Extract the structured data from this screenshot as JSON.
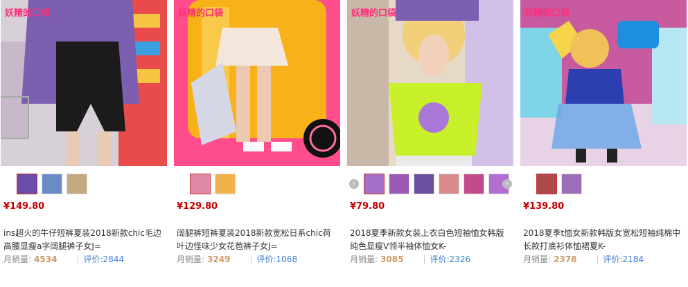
{
  "brand": "妖精的口袋",
  "products": [
    {
      "price": "¥149.80",
      "title": "ins超火的牛仔短裤夏装2018新款chic毛边高腰显瘦a字阔腿裤子女J=",
      "sales_label": "月销量:",
      "sales": "4534",
      "reviews_label": "评价:",
      "reviews": "2844",
      "colors": {
        "bg": "#7c5fb0",
        "accent": "#1b1b1b",
        "shelf": "#e94b4b"
      },
      "thumbs": [
        {
          "color": "#6b4ca8"
        },
        {
          "color": "#6a8cc4"
        },
        {
          "color": "#c4a882"
        }
      ]
    },
    {
      "price": "¥129.80",
      "title": "阔腿裤短裤夏装2018新款宽松日系chic荷叶边怪味少女花苞裤子女J=",
      "sales_label": "月销量:",
      "sales": "3249",
      "reviews_label": "评价:",
      "reviews": "1068",
      "colors": {
        "bg": "#f7b21a",
        "accent": "#f4e6dc",
        "shelf": "#ff4d8d"
      },
      "thumbs": [
        {
          "color": "#e08aa5"
        },
        {
          "color": "#f2b24a"
        }
      ]
    },
    {
      "price": "¥79.80",
      "title": "2018夏季新款女装上衣白色短袖恤女韩版纯色显瘦V领半袖体恤女K-",
      "sales_label": "月销量:",
      "sales": "3085",
      "reviews_label": "评价:",
      "reviews": "2326",
      "colors": {
        "bg": "#e7d9c8",
        "accent": "#c8f02a",
        "shelf": "#f2c7a6"
      },
      "thumbs": [
        {
          "color": "#a36fc7"
        },
        {
          "color": "#9b59b6"
        },
        {
          "color": "#6a4fa0"
        },
        {
          "color": "#d98b8b"
        },
        {
          "color": "#c24a8a"
        },
        {
          "color": "#b06fd1"
        }
      ]
    },
    {
      "price": "¥139.80",
      "title": "2018夏季t恤女新款韩版女宽松短袖纯棉中长款打底衫体恤裙夏K-",
      "sales_label": "月销量:",
      "sales": "2378",
      "reviews_label": "评价:",
      "reviews": "2184",
      "colors": {
        "bg": "#c85aa0",
        "accent": "#2c3fb0",
        "shelf": "#7fd4e8"
      },
      "thumbs": [
        {
          "color": "#b04a4a"
        },
        {
          "color": "#9a6fb8"
        }
      ]
    }
  ],
  "icons": {
    "prev": "chevron-left-icon",
    "next": "chevron-right-icon"
  }
}
